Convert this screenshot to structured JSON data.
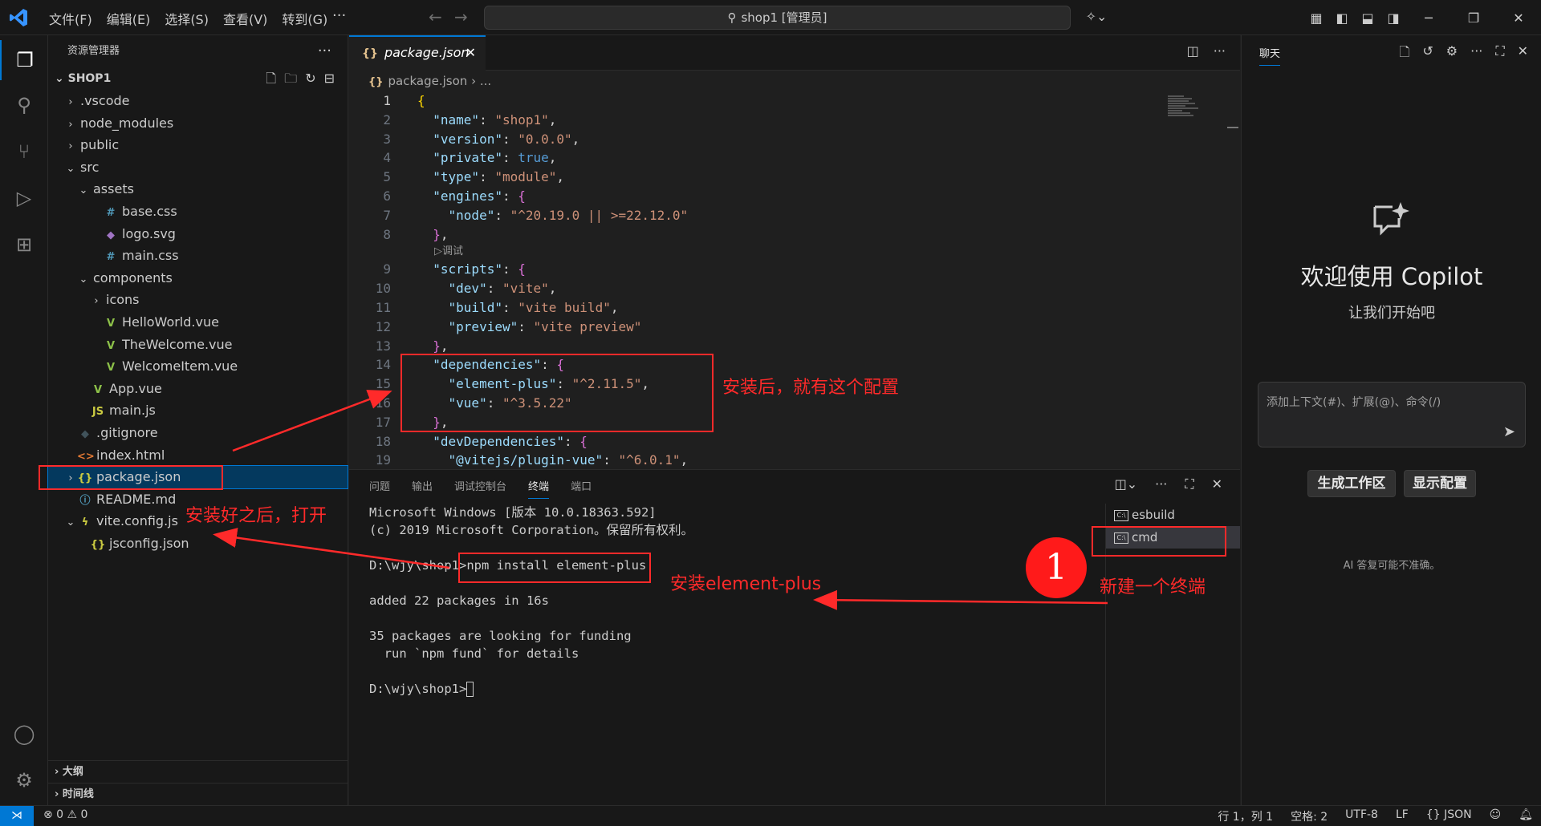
{
  "titlebar": {
    "menus": [
      "文件(F)",
      "编辑(E)",
      "选择(S)",
      "查看(V)",
      "转到(G)"
    ],
    "more": "···",
    "search": "shop1 [管理员]"
  },
  "explorer": {
    "title": "资源管理器",
    "project": "SHOP1",
    "tree": [
      {
        "label": ".vscode",
        "depth": 0,
        "chev": "›",
        "icon": "",
        "color": "#cccccc"
      },
      {
        "label": "node_modules",
        "depth": 0,
        "chev": "›",
        "icon": "",
        "color": "#cccccc"
      },
      {
        "label": "public",
        "depth": 0,
        "chev": "›",
        "icon": "",
        "color": "#cccccc"
      },
      {
        "label": "src",
        "depth": 0,
        "chev": "⌄",
        "icon": "",
        "color": "#cccccc"
      },
      {
        "label": "assets",
        "depth": 1,
        "chev": "⌄",
        "icon": "",
        "color": "#cccccc"
      },
      {
        "label": "base.css",
        "depth": 2,
        "chev": "",
        "icon": "#",
        "color": "#519aba"
      },
      {
        "label": "logo.svg",
        "depth": 2,
        "chev": "",
        "icon": "◆",
        "color": "#a074c4"
      },
      {
        "label": "main.css",
        "depth": 2,
        "chev": "",
        "icon": "#",
        "color": "#519aba"
      },
      {
        "label": "components",
        "depth": 1,
        "chev": "⌄",
        "icon": "",
        "color": "#cccccc"
      },
      {
        "label": "icons",
        "depth": 2,
        "chev": "›",
        "icon": "",
        "color": "#cccccc"
      },
      {
        "label": "HelloWorld.vue",
        "depth": 2,
        "chev": "",
        "icon": "V",
        "color": "#8dc149"
      },
      {
        "label": "TheWelcome.vue",
        "depth": 2,
        "chev": "",
        "icon": "V",
        "color": "#8dc149"
      },
      {
        "label": "WelcomeItem.vue",
        "depth": 2,
        "chev": "",
        "icon": "V",
        "color": "#8dc149"
      },
      {
        "label": "App.vue",
        "depth": 1,
        "chev": "",
        "icon": "V",
        "color": "#8dc149"
      },
      {
        "label": "main.js",
        "depth": 1,
        "chev": "",
        "icon": "JS",
        "color": "#cbcb41"
      },
      {
        "label": ".gitignore",
        "depth": 0,
        "chev": "",
        "icon": "◆",
        "color": "#41535b"
      },
      {
        "label": "index.html",
        "depth": 0,
        "chev": "",
        "icon": "<>",
        "color": "#e37933"
      },
      {
        "label": "package.json",
        "depth": 0,
        "chev": "›",
        "icon": "{}",
        "color": "#cbcb41",
        "selected": true
      },
      {
        "label": "README.md",
        "depth": 0,
        "chev": "",
        "icon": "ⓘ",
        "color": "#519aba"
      },
      {
        "label": "vite.config.js",
        "depth": 0,
        "chev": "⌄",
        "icon": "ϟ",
        "color": "#cbcb41"
      },
      {
        "label": "jsconfig.json",
        "depth": 1,
        "chev": "",
        "icon": "{}",
        "color": "#cbcb41"
      }
    ],
    "outline": "大纲",
    "timeline": "时间线"
  },
  "editor": {
    "tab_label": "package.json",
    "breadcrumb": "package.json",
    "breadcrumb_sep": "› ...",
    "codelens": "▷调试",
    "lines": [
      {
        "n": "1",
        "html": "<span class='br1'>{</span>"
      },
      {
        "n": "2",
        "html": "  <span class='k'>\"name\"</span><span class='p'>: </span><span class='s'>\"shop1\"</span><span class='p'>,</span>"
      },
      {
        "n": "3",
        "html": "  <span class='k'>\"version\"</span><span class='p'>: </span><span class='s'>\"0.0.0\"</span><span class='p'>,</span>"
      },
      {
        "n": "4",
        "html": "  <span class='k'>\"private\"</span><span class='p'>: </span><span class='b'>true</span><span class='p'>,</span>"
      },
      {
        "n": "5",
        "html": "  <span class='k'>\"type\"</span><span class='p'>: </span><span class='s'>\"module\"</span><span class='p'>,</span>"
      },
      {
        "n": "6",
        "html": "  <span class='k'>\"engines\"</span><span class='p'>: </span><span class='br2'>{</span>"
      },
      {
        "n": "7",
        "html": "    <span class='k'>\"node\"</span><span class='p'>: </span><span class='s'>\"^20.19.0 || >=22.12.0\"</span>"
      },
      {
        "n": "8",
        "html": "  <span class='br2'>}</span><span class='p'>,</span>"
      },
      {
        "n": "",
        "lens": true
      },
      {
        "n": "9",
        "html": "  <span class='k'>\"scripts\"</span><span class='p'>: </span><span class='br2'>{</span>"
      },
      {
        "n": "10",
        "html": "    <span class='k'>\"dev\"</span><span class='p'>: </span><span class='s'>\"vite\"</span><span class='p'>,</span>"
      },
      {
        "n": "11",
        "html": "    <span class='k'>\"build\"</span><span class='p'>: </span><span class='s'>\"vite build\"</span><span class='p'>,</span>"
      },
      {
        "n": "12",
        "html": "    <span class='k'>\"preview\"</span><span class='p'>: </span><span class='s'>\"vite preview\"</span>"
      },
      {
        "n": "13",
        "html": "  <span class='br2'>}</span><span class='p'>,</span>"
      },
      {
        "n": "14",
        "html": "  <span class='k'>\"dependencies\"</span><span class='p'>: </span><span class='br2'>{</span>"
      },
      {
        "n": "15",
        "html": "    <span class='k'>\"element-plus\"</span><span class='p'>: </span><span class='s'>\"^2.11.5\"</span><span class='p'>,</span>"
      },
      {
        "n": "16",
        "html": "    <span class='k'>\"vue\"</span><span class='p'>: </span><span class='s'>\"^3.5.22\"</span>"
      },
      {
        "n": "17",
        "html": "  <span class='br2'>}</span><span class='p'>,</span>"
      },
      {
        "n": "18",
        "html": "  <span class='k'>\"devDependencies\"</span><span class='p'>: </span><span class='br2'>{</span>"
      },
      {
        "n": "19",
        "html": "    <span class='k'>\"@vitejs/plugin-vue\"</span><span class='p'>: </span><span class='s'>\"^6.0.1\"</span><span class='p'>,</span>"
      }
    ]
  },
  "panel": {
    "tabs": [
      "问题",
      "输出",
      "调试控制台",
      "终端",
      "端口"
    ],
    "active_tab": "终端",
    "terminal_lines": [
      "Microsoft Windows [版本 10.0.18363.592]",
      "(c) 2019 Microsoft Corporation。保留所有权利。",
      "",
      "D:\\wjy\\shop1>npm install element-plus",
      "",
      "added 22 packages in 16s",
      "",
      "35 packages are looking for funding",
      "  run `npm fund` for details",
      "",
      "D:\\wjy\\shop1>"
    ],
    "terminals": [
      {
        "label": "esbuild",
        "selected": false
      },
      {
        "label": "cmd",
        "selected": true
      }
    ]
  },
  "chat": {
    "title": "聊天",
    "welcome": "欢迎使用 Copilot",
    "subtitle": "让我们开始吧",
    "placeholder": "添加上下文(#)、扩展(@)、命令(/)",
    "btn_generate": "生成工作区",
    "btn_show": "显示配置",
    "disclaimer": "AI 答复可能不准确。"
  },
  "statusbar": {
    "problems": "⊗ 0 ⚠ 0",
    "position": "行 1，列 1",
    "spaces": "空格: 2",
    "encoding": "UTF-8",
    "eol": "LF",
    "language": "{} JSON"
  },
  "annotations": {
    "config_note": "安装后，就有这个配置",
    "open_note": "安装好之后，打开",
    "install_note": "安装element-plus",
    "new_term_note": "新建一个终端",
    "step": "1"
  },
  "colors": {
    "accent": "#0078d4",
    "annotation": "#ff2a2a"
  }
}
